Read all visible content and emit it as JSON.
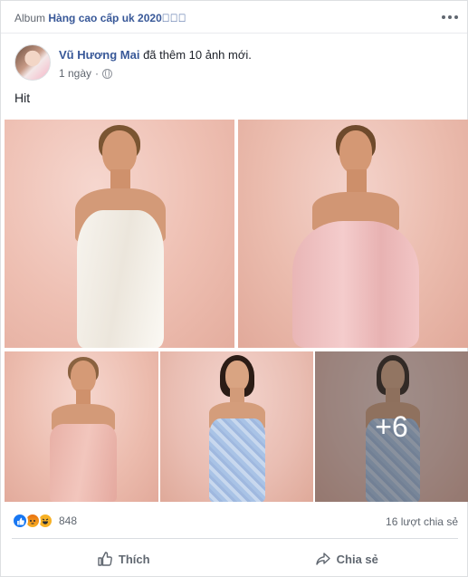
{
  "album": {
    "prefix": "Album",
    "name": "Hàng cao cấp uk 2020⃣⃣⃣"
  },
  "post": {
    "author": "Vũ Hương Mai",
    "action_text": "đã thêm 10 ảnh mới.",
    "time": "1 ngày",
    "privacy_separator": "·",
    "privacy_icon": "globe-icon",
    "text": "Hit"
  },
  "photos": {
    "more_overlay": "+6",
    "items": [
      {
        "alt": "white satin corset dress"
      },
      {
        "alt": "pink off-shoulder ruched dress"
      },
      {
        "alt": "pink satin mini dress"
      },
      {
        "alt": "light blue floral slip dress"
      },
      {
        "alt": "blue floral slip dress"
      }
    ]
  },
  "stats": {
    "reaction_icons": [
      "like-icon",
      "angry-icon",
      "haha-icon"
    ],
    "reaction_count": "848",
    "share_count": "16 lượt chia sẻ"
  },
  "actions": {
    "like": "Thích",
    "share": "Chia sẻ"
  },
  "colors": {
    "link": "#385898",
    "meta": "#616770",
    "like_blue": "#1877f2"
  }
}
